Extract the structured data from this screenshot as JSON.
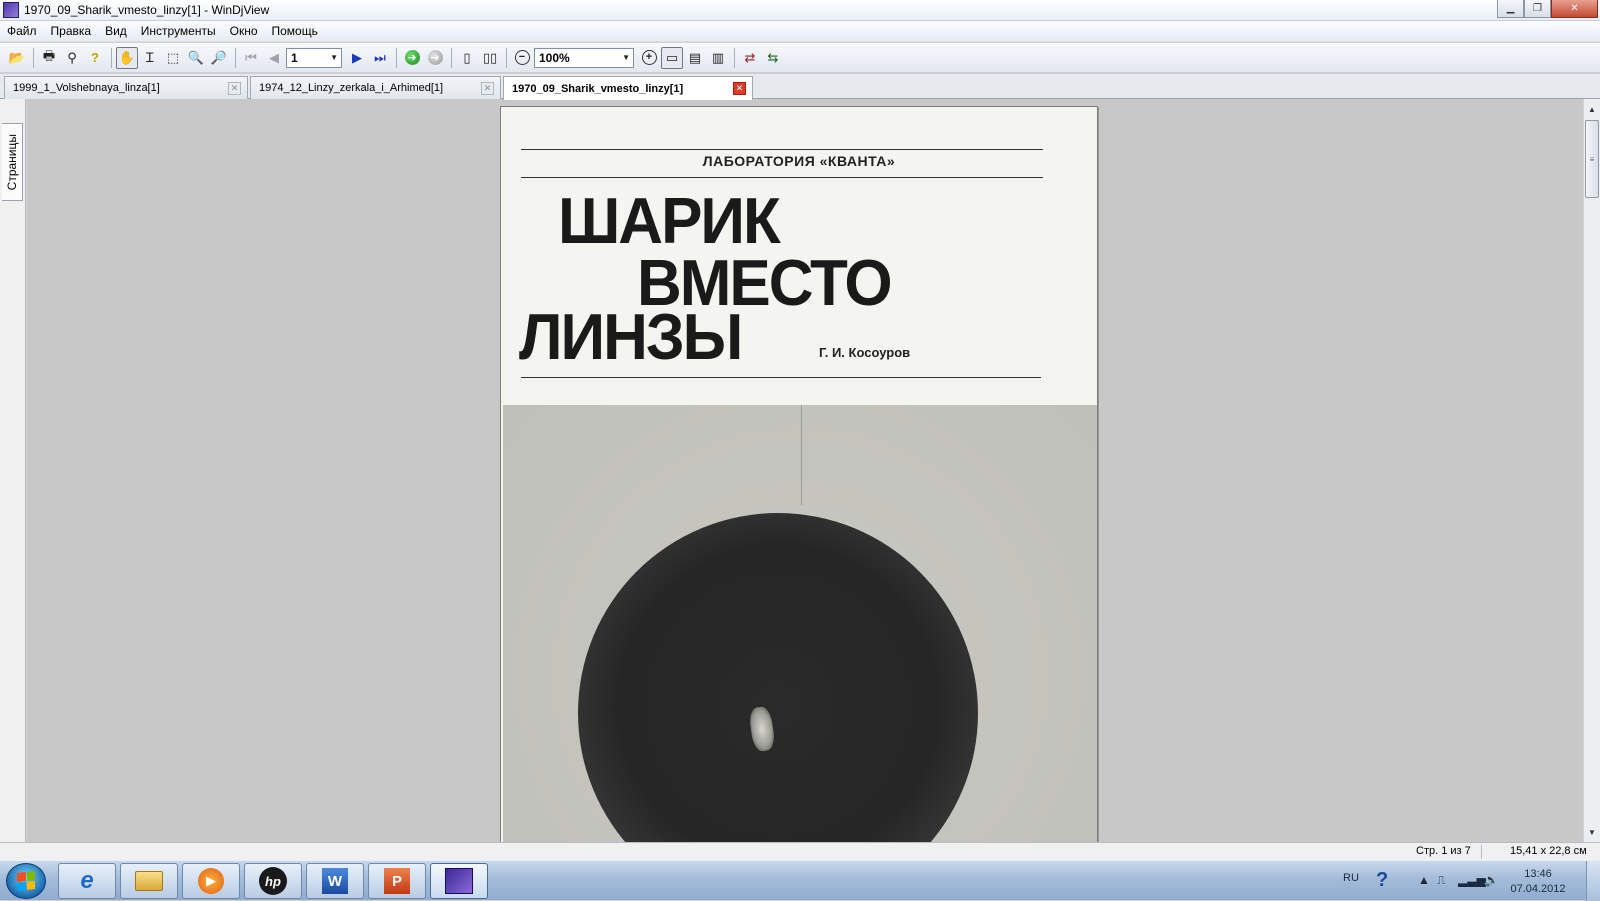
{
  "window": {
    "title": "1970_09_Sharik_vmesto_linzy[1] - WinDjView"
  },
  "menu": [
    "Файл",
    "Правка",
    "Вид",
    "Инструменты",
    "Окно",
    "Помощь"
  ],
  "toolbar": {
    "page_number": "1",
    "zoom": "100%"
  },
  "tabs": [
    {
      "label": "1999_1_Volshebnaya_linza[1]",
      "active": false
    },
    {
      "label": "1974_12_Linzy_zerkala_i_Arhimed[1]",
      "active": false
    },
    {
      "label": "1970_09_Sharik_vmesto_linzy[1]",
      "active": true
    }
  ],
  "side_panel": {
    "tab_label": "Страницы"
  },
  "document": {
    "header": "ЛАБОРАТОРИЯ «КВАНТА»",
    "title_line1": "ШАРИК",
    "title_line2": "ВМЕСТО",
    "title_line3": "ЛИНЗЫ",
    "author": "Г. И. Косоуров"
  },
  "status": {
    "page": "Стр. 1 из 7",
    "size": "15,41 x 22,8 см"
  },
  "taskbar": {
    "language": "RU",
    "time": "13:46",
    "date": "07.04.2012",
    "apps": [
      "internet-explorer",
      "windows-explorer",
      "media-player",
      "hp",
      "word",
      "powerpoint",
      "windjview"
    ]
  },
  "colors": {
    "active_tab_close": "#e03a2a",
    "taskbar": "#a4bcd8",
    "viewer_bg": "#c8c8c8"
  }
}
